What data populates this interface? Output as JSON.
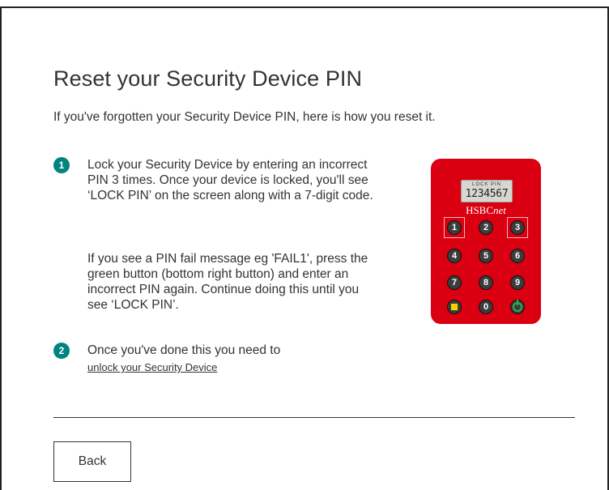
{
  "page": {
    "title": "Reset your Security Device PIN",
    "intro": "If you've forgotten your Security Device PIN, here is how you reset it."
  },
  "steps": [
    {
      "number": "1",
      "paragraphs": [
        "Lock your Security Device by entering an incorrect PIN 3 times. Once your device is locked, you'll see ‘LOCK PIN’ on the screen along with a 7-digit code.",
        "If you see a PIN fail message eg 'FAIL1', press the green button (bottom right button) and enter an incorrect PIN again. Continue doing this until you see ‘LOCK PIN’."
      ]
    },
    {
      "number": "2",
      "text": "Once you've done this you need to",
      "link": "unlock your Security Device"
    }
  ],
  "device": {
    "screen_top": "LOCK  PIN",
    "screen_code": "1234567",
    "brand": "HSBCnet",
    "keys": [
      "1",
      "2",
      "3",
      "4",
      "5",
      "6",
      "7",
      "8",
      "9",
      "0"
    ],
    "bottom_left_icon": "yellow-square-icon",
    "bottom_right_icon": "green-power-icon",
    "colors": {
      "body": "#db0011",
      "accent": "#00847f",
      "green": "#2bb34a",
      "yellow": "#f5d200"
    }
  },
  "footer": {
    "back_label": "Back"
  }
}
